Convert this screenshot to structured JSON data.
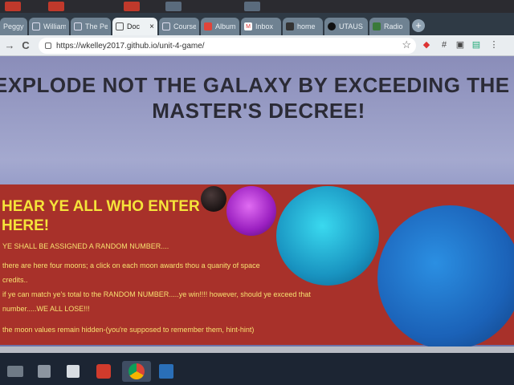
{
  "browser": {
    "tabs": [
      {
        "title": "Peggy's",
        "favicon": "page-icon",
        "active": false
      },
      {
        "title": "William",
        "favicon": "page-icon",
        "active": false
      },
      {
        "title": "The Pe",
        "favicon": "page-icon",
        "active": false
      },
      {
        "title": "Doc",
        "favicon": "page-icon",
        "active": true
      },
      {
        "title": "Course",
        "favicon": "page-icon",
        "active": false
      },
      {
        "title": "Album",
        "favicon": "album-icon",
        "active": false
      },
      {
        "title": "Inbox",
        "favicon": "gmail-icon",
        "active": false
      },
      {
        "title": "home",
        "favicon": "home-icon",
        "active": false
      },
      {
        "title": "UTAUS",
        "favicon": "github-icon",
        "active": false
      },
      {
        "title": "Radio",
        "favicon": "radio-icon",
        "active": false
      }
    ],
    "tab_close_glyph": "×",
    "new_tab_glyph": "+",
    "url": "https://wkelley2017.github.io/unit-4-game/",
    "nav": {
      "back": "→",
      "reload": "C"
    },
    "star_glyph": "☆"
  },
  "page": {
    "title_line1": "EXPLODE NOT THE GALAXY BY EXCEEDING THE MOON",
    "title_line2": "MASTER'S DECREE!",
    "panel": {
      "heading": "HEAR YE ALL WHO ENTER HERE!",
      "line1": "YE SHALL BE ASSIGNED A RANDOM NUMBER....",
      "line2": "there are here four moons; a click on each moon awards thou a quanity of space credits..",
      "line3": "if ye can match ye's total to the RANDOM NUMBER.....ye win!!!! however, should ye exceed that number.....WE ALL LOSE!!!",
      "line4": "the moon values remain hidden-(you're supposed to remember them, hint-hint)"
    },
    "moons": [
      "dark-moon",
      "purple-moon",
      "cyan-moon",
      "blue-moon"
    ]
  },
  "colors": {
    "panel_bg": "#a8312a",
    "panel_heading": "#f5e43a",
    "panel_text": "#f7e070",
    "title_text": "#2b2b36"
  }
}
